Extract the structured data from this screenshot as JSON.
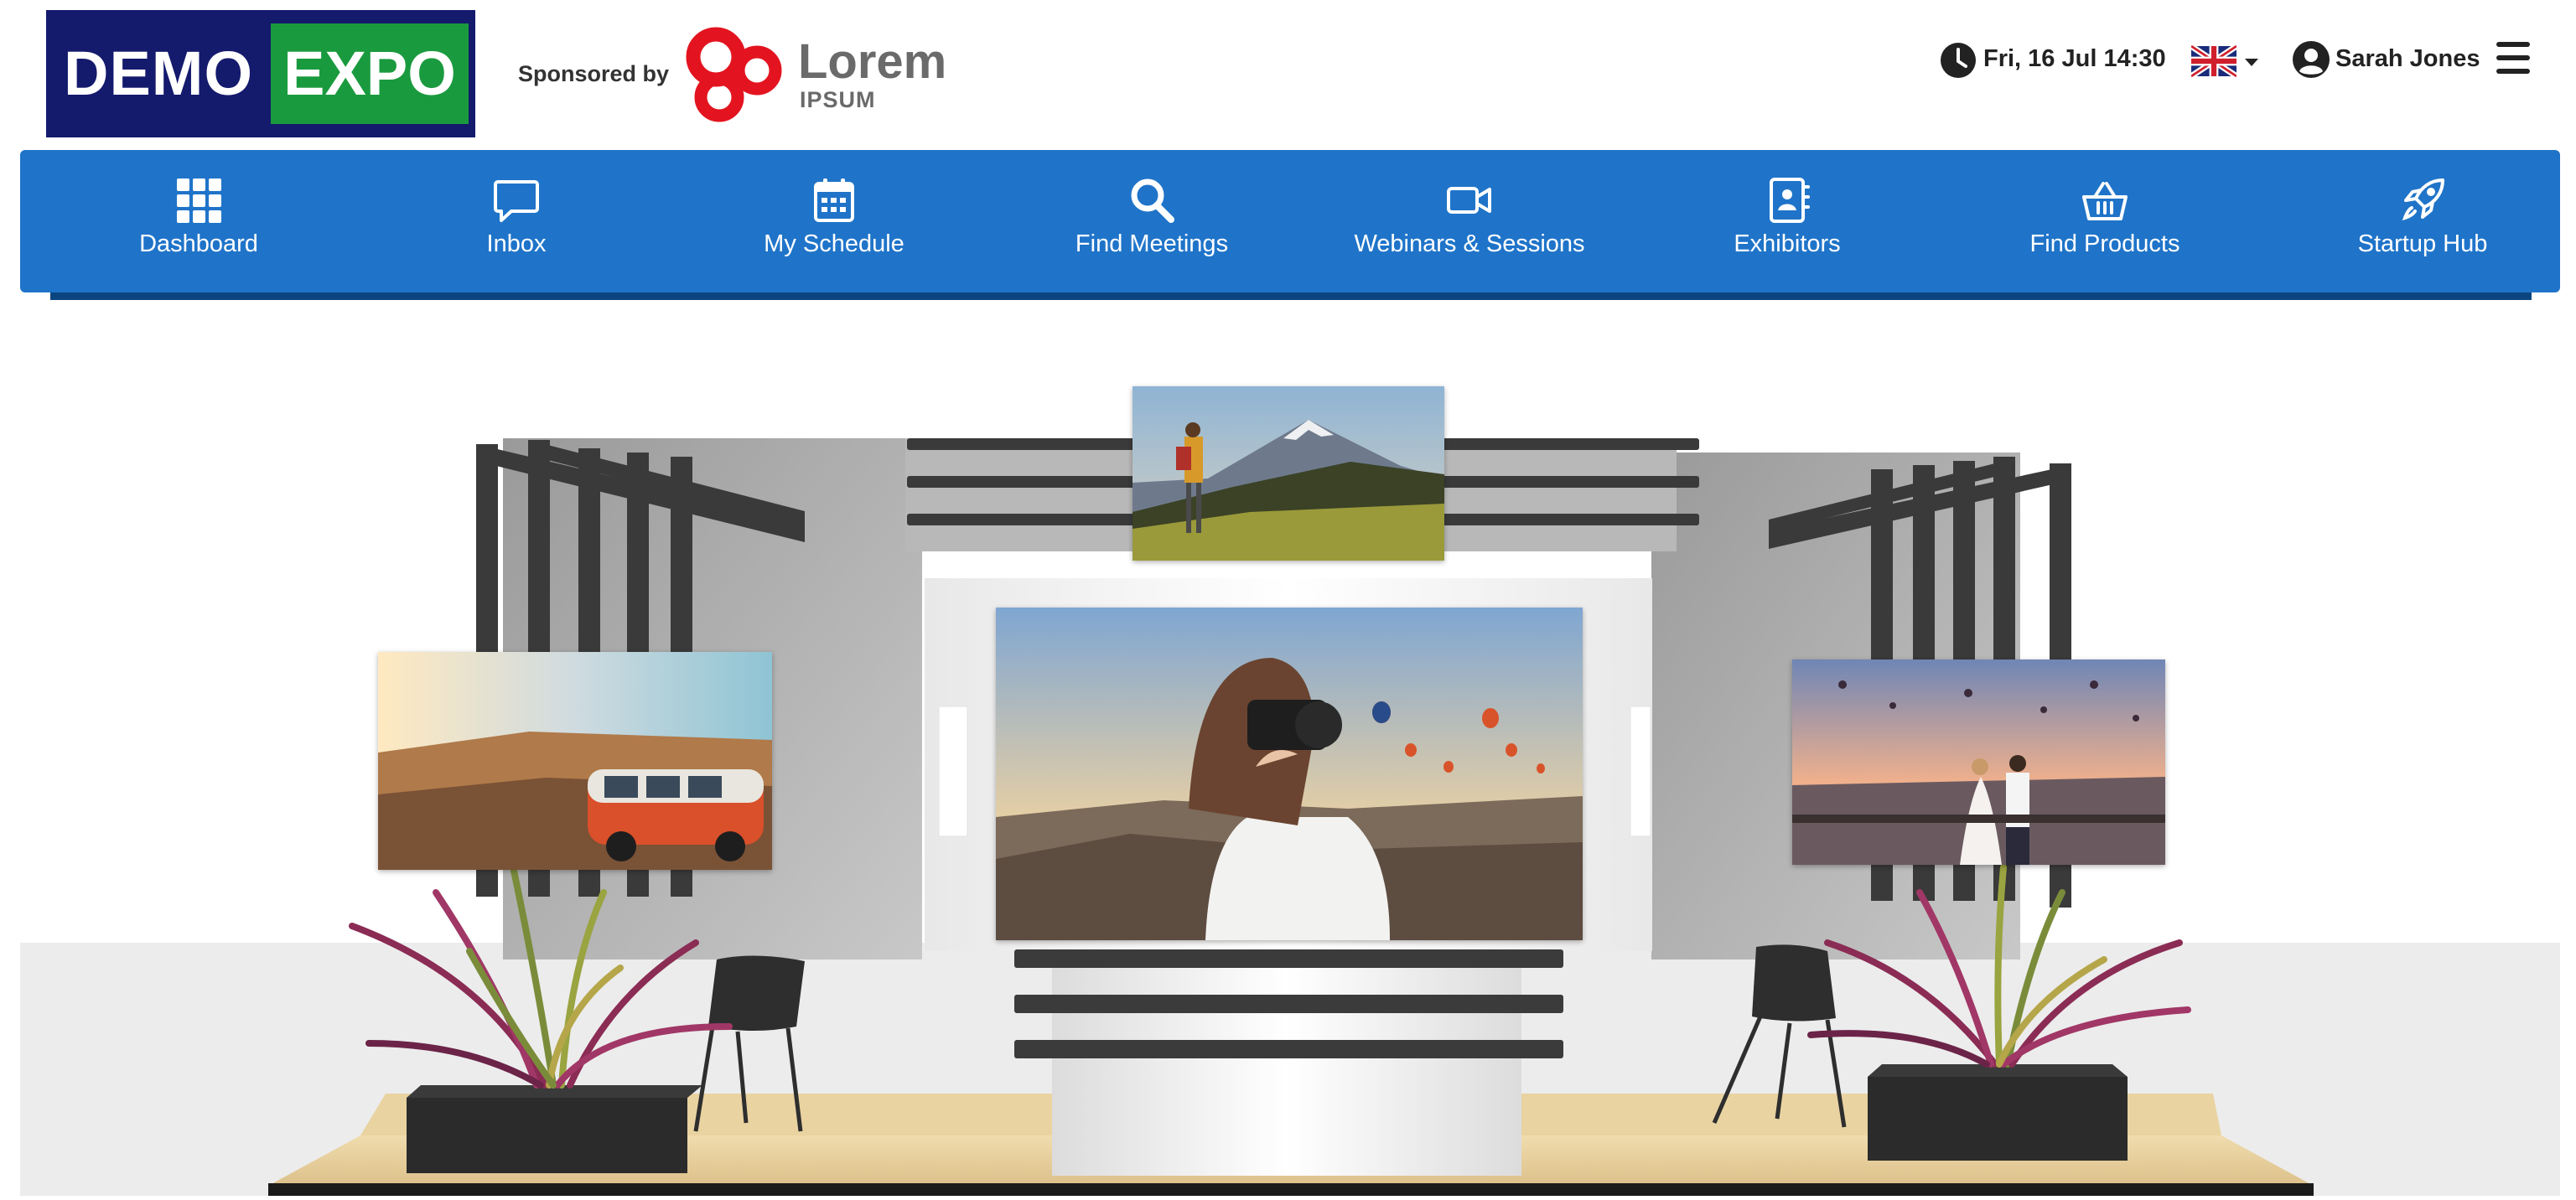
{
  "header": {
    "logo": {
      "word1": "DEMO",
      "word2": "EXPO"
    },
    "sponsor": {
      "label": "Sponsored by",
      "name": "Lorem",
      "subname": "IPSUM"
    },
    "datetime": "Fri, 16 Jul  14:30",
    "language": {
      "selected": "English (UK)",
      "icon": "uk-flag-icon"
    },
    "user": {
      "name": "Sarah Jones",
      "icon": "user-circle-icon"
    },
    "menu_icon": "hamburger-menu-icon",
    "clock_icon": "clock-icon"
  },
  "nav": {
    "items": [
      {
        "label": "Dashboard",
        "icon": "grid-icon"
      },
      {
        "label": "Inbox",
        "icon": "chat-bubble-icon"
      },
      {
        "label": "My Schedule",
        "icon": "calendar-icon"
      },
      {
        "label": "Find Meetings",
        "icon": "search-icon"
      },
      {
        "label": "Webinars & Sessions",
        "icon": "video-camera-icon"
      },
      {
        "label": "Exhibitors",
        "icon": "contact-book-icon"
      },
      {
        "label": "Find Products",
        "icon": "basket-icon"
      },
      {
        "label": "Startup Hub",
        "icon": "rocket-icon"
      }
    ]
  },
  "booth": {
    "screens": [
      {
        "name": "top-screen",
        "depicts": "hiker-with-camera-mountain"
      },
      {
        "name": "main-screen",
        "depicts": "woman-photographer-balloons"
      },
      {
        "name": "left-screen",
        "depicts": "van-sunset-valley"
      },
      {
        "name": "right-screen",
        "depicts": "couple-rooftop-balloons"
      }
    ]
  },
  "colors": {
    "nav_bg": "#1f74c9",
    "logo_navy": "#141a6c",
    "logo_green": "#1a9a3e",
    "sponsor_red": "#e3141f"
  }
}
